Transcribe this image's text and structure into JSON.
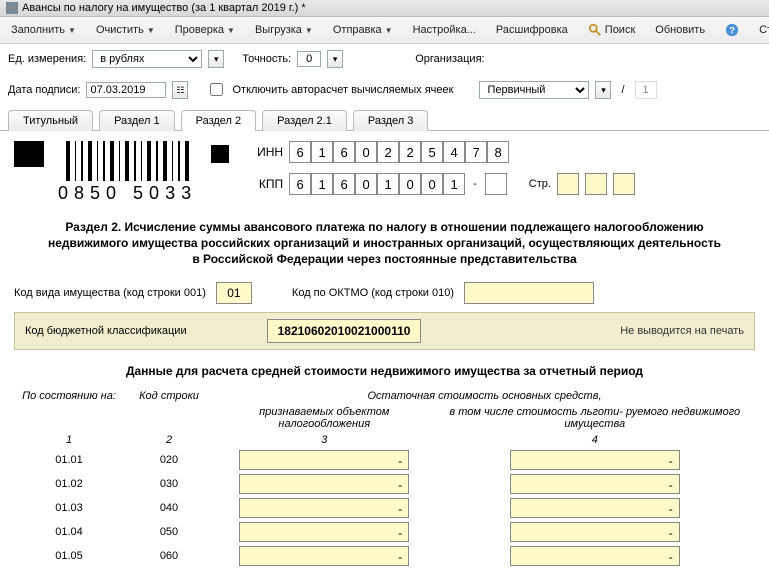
{
  "title": "Авансы по налогу на имущество (за 1 квартал 2019 г.) *",
  "toolbar": {
    "fill": "Заполнить",
    "clear": "Очистить",
    "check": "Проверка",
    "upload": "Выгрузка",
    "send": "Отправка",
    "settings": "Настройка...",
    "detail": "Расшифровка",
    "search": "Поиск",
    "refresh": "Обновить",
    "rates": "Ставки налога на иму"
  },
  "params": {
    "unit_label": "Ед. измерения:",
    "unit_value": "в рублях",
    "precision_label": "Точность:",
    "precision_value": "0",
    "org_label": "Организация:",
    "date_label": "Дата подписи:",
    "date_value": "07.03.2019",
    "autocalc_label": "Отключить авторасчет вычисляемых ячеек",
    "kind_value": "Первичный",
    "page_num": "1"
  },
  "tabs": [
    "Титульный",
    "Раздел 1",
    "Раздел 2",
    "Раздел 2.1",
    "Раздел 3"
  ],
  "active_tab": 2,
  "barcode_text": "0850 5033",
  "inn_label": "ИНН",
  "kpp_label": "КПП",
  "inn_digits": [
    "6",
    "1",
    "6",
    "0",
    "2",
    "2",
    "5",
    "4",
    "7",
    "8"
  ],
  "kpp_digits": [
    "6",
    "1",
    "6",
    "0",
    "1",
    "0",
    "0",
    "1"
  ],
  "page_label": "Стр.",
  "section_title": "Раздел 2. Исчисление суммы авансового платежа по налогу в отношении подлежащего налогообложению недвижимого имущества российских организаций и иностранных организаций, осуществляющих деятельность в Российской Федерации через постоянные представительства",
  "line1": {
    "a": "Код вида имущества (код строки 001)",
    "v": "01",
    "b": "Код по ОКТМО (код строки 010)"
  },
  "kbk": {
    "label": "Код бюджетной классификации",
    "value": "18210602010021000110",
    "noprint": "Не выводится на печать"
  },
  "subhead": "Данные для расчета средней стоимости недвижимого имущества за отчетный период",
  "thead": {
    "c1": "По состоянию на:",
    "c2": "Код строки",
    "c3a": "Остаточная стоимость основных средств,",
    "c3b": "признаваемых объектом налогообложения",
    "c4b": "в том числе стоимость льготи- руемого недвижимого имущества",
    "n1": "1",
    "n2": "2",
    "n3": "3",
    "n4": "4"
  },
  "rows": [
    {
      "date": "01.01",
      "code": "020",
      "v3": "-",
      "v4": "-"
    },
    {
      "date": "01.02",
      "code": "030",
      "v3": "-",
      "v4": "-"
    },
    {
      "date": "01.03",
      "code": "040",
      "v3": "-",
      "v4": "-"
    },
    {
      "date": "01.04",
      "code": "050",
      "v3": "-",
      "v4": "-"
    },
    {
      "date": "01.05",
      "code": "060",
      "v3": "-",
      "v4": "-"
    }
  ]
}
